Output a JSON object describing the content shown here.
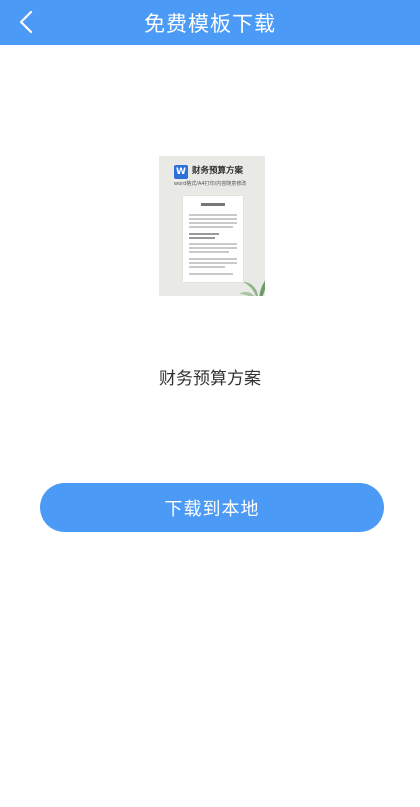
{
  "header": {
    "title": "免费模板下载",
    "back_icon": "chevron-left-icon"
  },
  "template": {
    "name": "财务预算方案",
    "thumbnail": {
      "title": "财务预算方案",
      "subtitle": "word格式/A4打印/内容随意修改",
      "app_icon": "word-icon",
      "app_icon_letter": "W"
    }
  },
  "actions": {
    "download_label": "下载到本地"
  },
  "colors": {
    "accent": "#4a9af6",
    "background": "#ffffff",
    "text": "#333333"
  }
}
